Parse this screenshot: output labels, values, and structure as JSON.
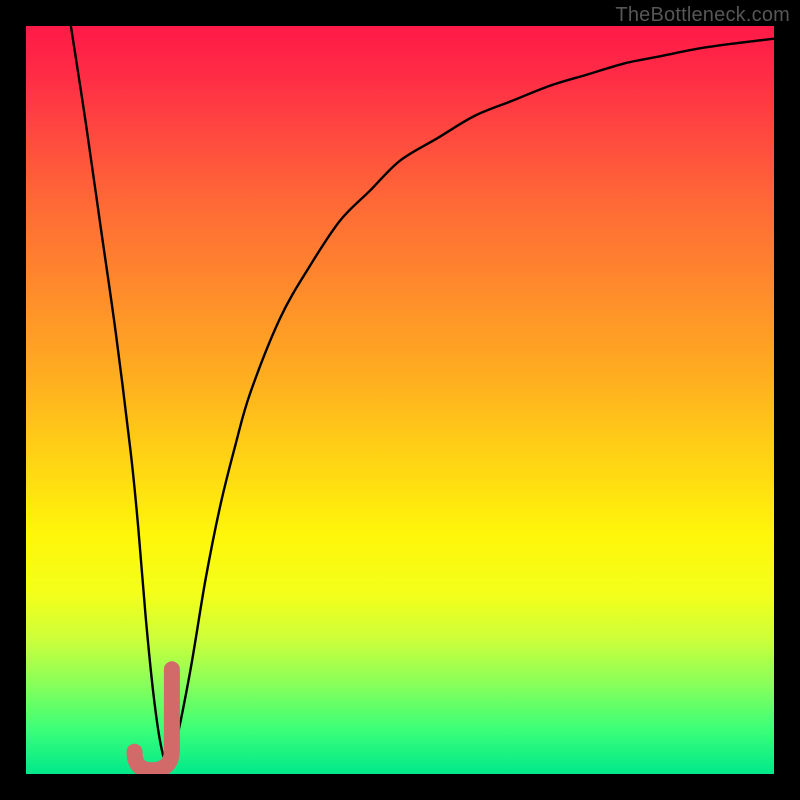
{
  "watermark": "TheBottleneck.com",
  "colors": {
    "frame": "#000000",
    "curve_stroke": "#000000",
    "marker_stroke": "#d26a6a",
    "gradient_stops": [
      {
        "offset": 0.0,
        "color": "#ff1a47"
      },
      {
        "offset": 0.06,
        "color": "#ff2a46"
      },
      {
        "offset": 0.14,
        "color": "#ff4740"
      },
      {
        "offset": 0.24,
        "color": "#ff6a36"
      },
      {
        "offset": 0.36,
        "color": "#ff8d2b"
      },
      {
        "offset": 0.48,
        "color": "#ffb11f"
      },
      {
        "offset": 0.58,
        "color": "#ffd414"
      },
      {
        "offset": 0.68,
        "color": "#fff60a"
      },
      {
        "offset": 0.76,
        "color": "#f3ff1a"
      },
      {
        "offset": 0.82,
        "color": "#ccff3a"
      },
      {
        "offset": 0.88,
        "color": "#88ff5a"
      },
      {
        "offset": 0.94,
        "color": "#3cff78"
      },
      {
        "offset": 1.0,
        "color": "#00e88a"
      }
    ]
  },
  "chart_data": {
    "type": "line",
    "xlabel": "",
    "ylabel": "",
    "xlim": [
      0,
      100
    ],
    "ylim": [
      0,
      100
    ],
    "grid": false,
    "series": [
      {
        "name": "bottleneck-curve",
        "x": [
          6,
          8,
          10,
          12,
          14,
          15,
          16,
          17,
          18,
          19,
          20,
          22,
          24,
          26,
          28,
          30,
          34,
          38,
          42,
          46,
          50,
          55,
          60,
          65,
          70,
          75,
          80,
          85,
          90,
          95,
          100
        ],
        "y": [
          100,
          87,
          73,
          59,
          43,
          33,
          21,
          11,
          4,
          1,
          4,
          14,
          26,
          36,
          44,
          51,
          61,
          68,
          74,
          78,
          82,
          85,
          88,
          90,
          92,
          93.5,
          95,
          96,
          97,
          97.7,
          98.3
        ]
      }
    ],
    "marker": {
      "name": "optimal-J",
      "x_range": [
        14.5,
        19.5
      ],
      "y_range": [
        0.5,
        14
      ],
      "shape": "J"
    }
  }
}
